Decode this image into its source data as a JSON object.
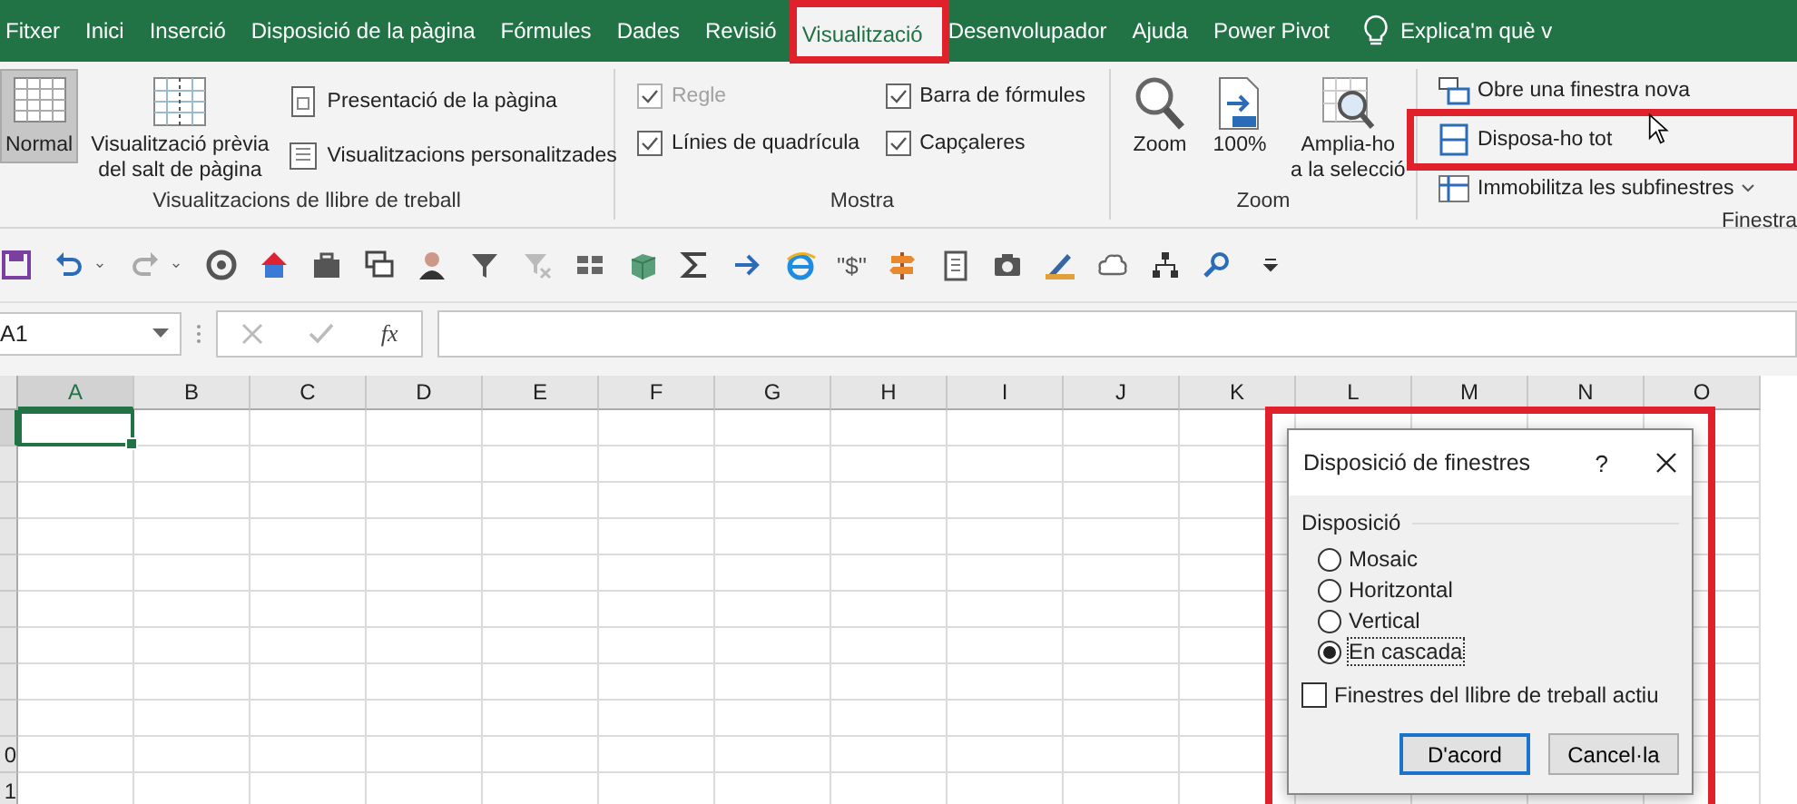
{
  "tabs": [
    {
      "label": "Fitxer",
      "selected": false,
      "highlighted": false
    },
    {
      "label": "Inici",
      "selected": false,
      "highlighted": false
    },
    {
      "label": "Inserció",
      "selected": false,
      "highlighted": false
    },
    {
      "label": "Disposició de la pàgina",
      "selected": false,
      "highlighted": false
    },
    {
      "label": "Fórmules",
      "selected": false,
      "highlighted": false
    },
    {
      "label": "Dades",
      "selected": false,
      "highlighted": false
    },
    {
      "label": "Revisió",
      "selected": false,
      "highlighted": false
    },
    {
      "label": "Visualització",
      "selected": true,
      "highlighted": true
    },
    {
      "label": "Desenvolupador",
      "selected": false,
      "highlighted": false
    },
    {
      "label": "Ajuda",
      "selected": false,
      "highlighted": false
    },
    {
      "label": "Power Pivot",
      "selected": false,
      "highlighted": false
    }
  ],
  "tell_me": {
    "label": "Explica'm què v"
  },
  "workbook_views": {
    "title": "Visualitzacions de llibre de treball",
    "large": [
      {
        "label": "Normal",
        "selected": true
      },
      {
        "label": "Visualització prèvia\ndel salt de pàgina",
        "selected": false
      }
    ],
    "small": [
      "Presentació de la pàgina",
      "Visualitzacions personalitzades"
    ]
  },
  "show": {
    "title": "Mostra",
    "options": [
      {
        "label": "Regle",
        "checked": true,
        "disabled": true
      },
      {
        "label": "Línies de quadrícula",
        "checked": true,
        "disabled": false
      },
      {
        "label": "Barra de fórmules",
        "checked": true,
        "disabled": false
      },
      {
        "label": "Capçaleres",
        "checked": true,
        "disabled": false
      }
    ]
  },
  "zoom": {
    "title": "Zoom",
    "commands": [
      "Zoom",
      "100%",
      "Amplia-ho\na la selecció"
    ]
  },
  "window_group": {
    "title": "Finestra",
    "commands": [
      {
        "label": "Obre una finestra nova",
        "highlighted": false,
        "has_menu": false
      },
      {
        "label": "Disposa-ho tot",
        "highlighted": true,
        "has_menu": false
      },
      {
        "label": "Immobilitza les subfinestres",
        "highlighted": false,
        "has_menu": true
      }
    ]
  },
  "quick_access": {
    "currency_label": "\"$\""
  },
  "formula_bar": {
    "name_box": "A1",
    "function_label": "fx"
  },
  "sheet": {
    "columns": [
      {
        "label": "A",
        "selected": true
      },
      {
        "label": "B",
        "selected": false
      },
      {
        "label": "C",
        "selected": false
      },
      {
        "label": "D",
        "selected": false
      },
      {
        "label": "E",
        "selected": false
      },
      {
        "label": "F",
        "selected": false
      },
      {
        "label": "G",
        "selected": false
      },
      {
        "label": "H",
        "selected": false
      },
      {
        "label": "I",
        "selected": false
      },
      {
        "label": "J",
        "selected": false
      },
      {
        "label": "K",
        "selected": false
      },
      {
        "label": "L",
        "selected": false
      },
      {
        "label": "M",
        "selected": false
      },
      {
        "label": "N",
        "selected": false
      },
      {
        "label": "O",
        "selected": false
      }
    ],
    "rows": [
      {
        "selected": true
      },
      {
        "selected": false
      },
      {
        "selected": false
      },
      {
        "selected": false
      },
      {
        "selected": false
      },
      {
        "selected": false
      },
      {
        "selected": false
      },
      {
        "selected": false
      },
      {
        "selected": false
      },
      {
        "label": "0",
        "selected": false
      },
      {
        "label": "1",
        "selected": false
      }
    ]
  },
  "dialog": {
    "title": "Disposició de finestres",
    "help": "?",
    "highlighted": true,
    "group_label": "Disposició",
    "options": [
      {
        "label": "Mosaic",
        "selected": false
      },
      {
        "label": "Horitzontal",
        "selected": false
      },
      {
        "label": "Vertical",
        "selected": false
      },
      {
        "label": "En cascada",
        "selected": true
      }
    ],
    "checkbox": {
      "label": "Finestres del llibre de treball actiu",
      "checked": false
    },
    "buttons": [
      {
        "label": "D'acord",
        "default": true
      },
      {
        "label": "Cancel·la",
        "default": false
      }
    ]
  }
}
